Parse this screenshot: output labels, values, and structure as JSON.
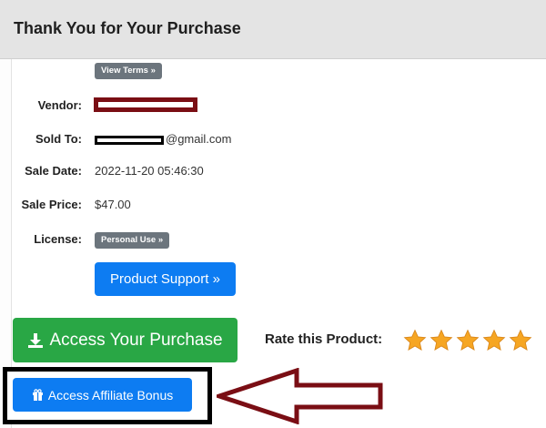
{
  "header": {
    "title": "Thank You for Your Purchase"
  },
  "terms_badge": "View Terms »",
  "details": {
    "vendor_label": "Vendor:",
    "sold_to_label": "Sold To:",
    "sold_to_suffix": "@gmail.com",
    "sale_date_label": "Sale Date:",
    "sale_date": "2022-11-20 05:46:30",
    "sale_price_label": "Sale Price:",
    "sale_price": "$47.00",
    "license_label": "License:",
    "license_badge": "Personal Use »"
  },
  "buttons": {
    "product_support": "Product Support »",
    "access_purchase": "Access Your Purchase",
    "affiliate_bonus": "Access Affiliate Bonus"
  },
  "rating": {
    "label": "Rate this Product:",
    "stars": 5
  },
  "colors": {
    "green": "#29a745",
    "blue": "#0d7cf2",
    "star": "#f6a623",
    "annotation": "#7a0e14"
  },
  "icons": {
    "download": "download-icon",
    "gift": "gift-icon",
    "star": "star-icon"
  }
}
